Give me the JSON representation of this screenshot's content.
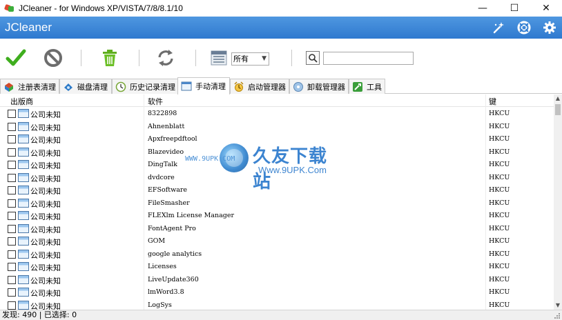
{
  "window": {
    "title": "JCleaner - for Windows XP/VISTA/7/8/8.1/10",
    "controls": {
      "minimize": "—",
      "maximize": "☐",
      "close": "✕"
    }
  },
  "header": {
    "title": "JCleaner",
    "icons": [
      "magic-wand-icon",
      "help-lifebuoy-icon",
      "gear-icon"
    ]
  },
  "toolbar": {
    "buttons": [
      "check-icon",
      "cancel-icon",
      "trash-icon",
      "refresh-icon",
      "filter-list-icon"
    ],
    "filter_value": "所有",
    "search_value": ""
  },
  "tabs": [
    {
      "label": "注册表清理",
      "icon": "registry-icon"
    },
    {
      "label": "磁盘清理",
      "icon": "disk-icon"
    },
    {
      "label": "历史记录清理",
      "icon": "history-icon"
    },
    {
      "label": "手动清理",
      "icon": "window-icon",
      "active": true
    },
    {
      "label": "启动管理器",
      "icon": "startup-icon"
    },
    {
      "label": "卸载管理器",
      "icon": "uninstall-icon"
    },
    {
      "label": "工具",
      "icon": "tools-icon"
    }
  ],
  "table": {
    "columns": [
      "出版商",
      "软件",
      "键"
    ],
    "rows": [
      {
        "publisher": "公司未知",
        "software": "8322898",
        "key": "HKCU"
      },
      {
        "publisher": "公司未知",
        "software": "Ahnenblatt",
        "key": "HKCU"
      },
      {
        "publisher": "公司未知",
        "software": "Apxfreepdftool",
        "key": "HKCU"
      },
      {
        "publisher": "公司未知",
        "software": "Blazevideo",
        "key": "HKCU"
      },
      {
        "publisher": "公司未知",
        "software": "DingTalk",
        "key": "HKCU"
      },
      {
        "publisher": "公司未知",
        "software": "dvdcore",
        "key": "HKCU"
      },
      {
        "publisher": "公司未知",
        "software": "EFSoftware",
        "key": "HKCU"
      },
      {
        "publisher": "公司未知",
        "software": "FileSmasher",
        "key": "HKCU"
      },
      {
        "publisher": "公司未知",
        "software": "FLEXlm License Manager",
        "key": "HKCU"
      },
      {
        "publisher": "公司未知",
        "software": "FontAgent Pro",
        "key": "HKCU"
      },
      {
        "publisher": "公司未知",
        "software": "GOM",
        "key": "HKCU"
      },
      {
        "publisher": "公司未知",
        "software": "google analytics",
        "key": "HKCU"
      },
      {
        "publisher": "公司未知",
        "software": "Licenses",
        "key": "HKCU"
      },
      {
        "publisher": "公司未知",
        "software": "LiveUpdate360",
        "key": "HKCU"
      },
      {
        "publisher": "公司未知",
        "software": "lmWord3.8",
        "key": "HKCU"
      },
      {
        "publisher": "公司未知",
        "software": "LogSys",
        "key": "HKCU"
      }
    ]
  },
  "watermark": {
    "brand": "久友下载站",
    "url_small": "WWW.9UPK.COM",
    "url": "Www.9UPK.Com"
  },
  "status": {
    "text": "发现: 490 | 已选择: 0"
  }
}
